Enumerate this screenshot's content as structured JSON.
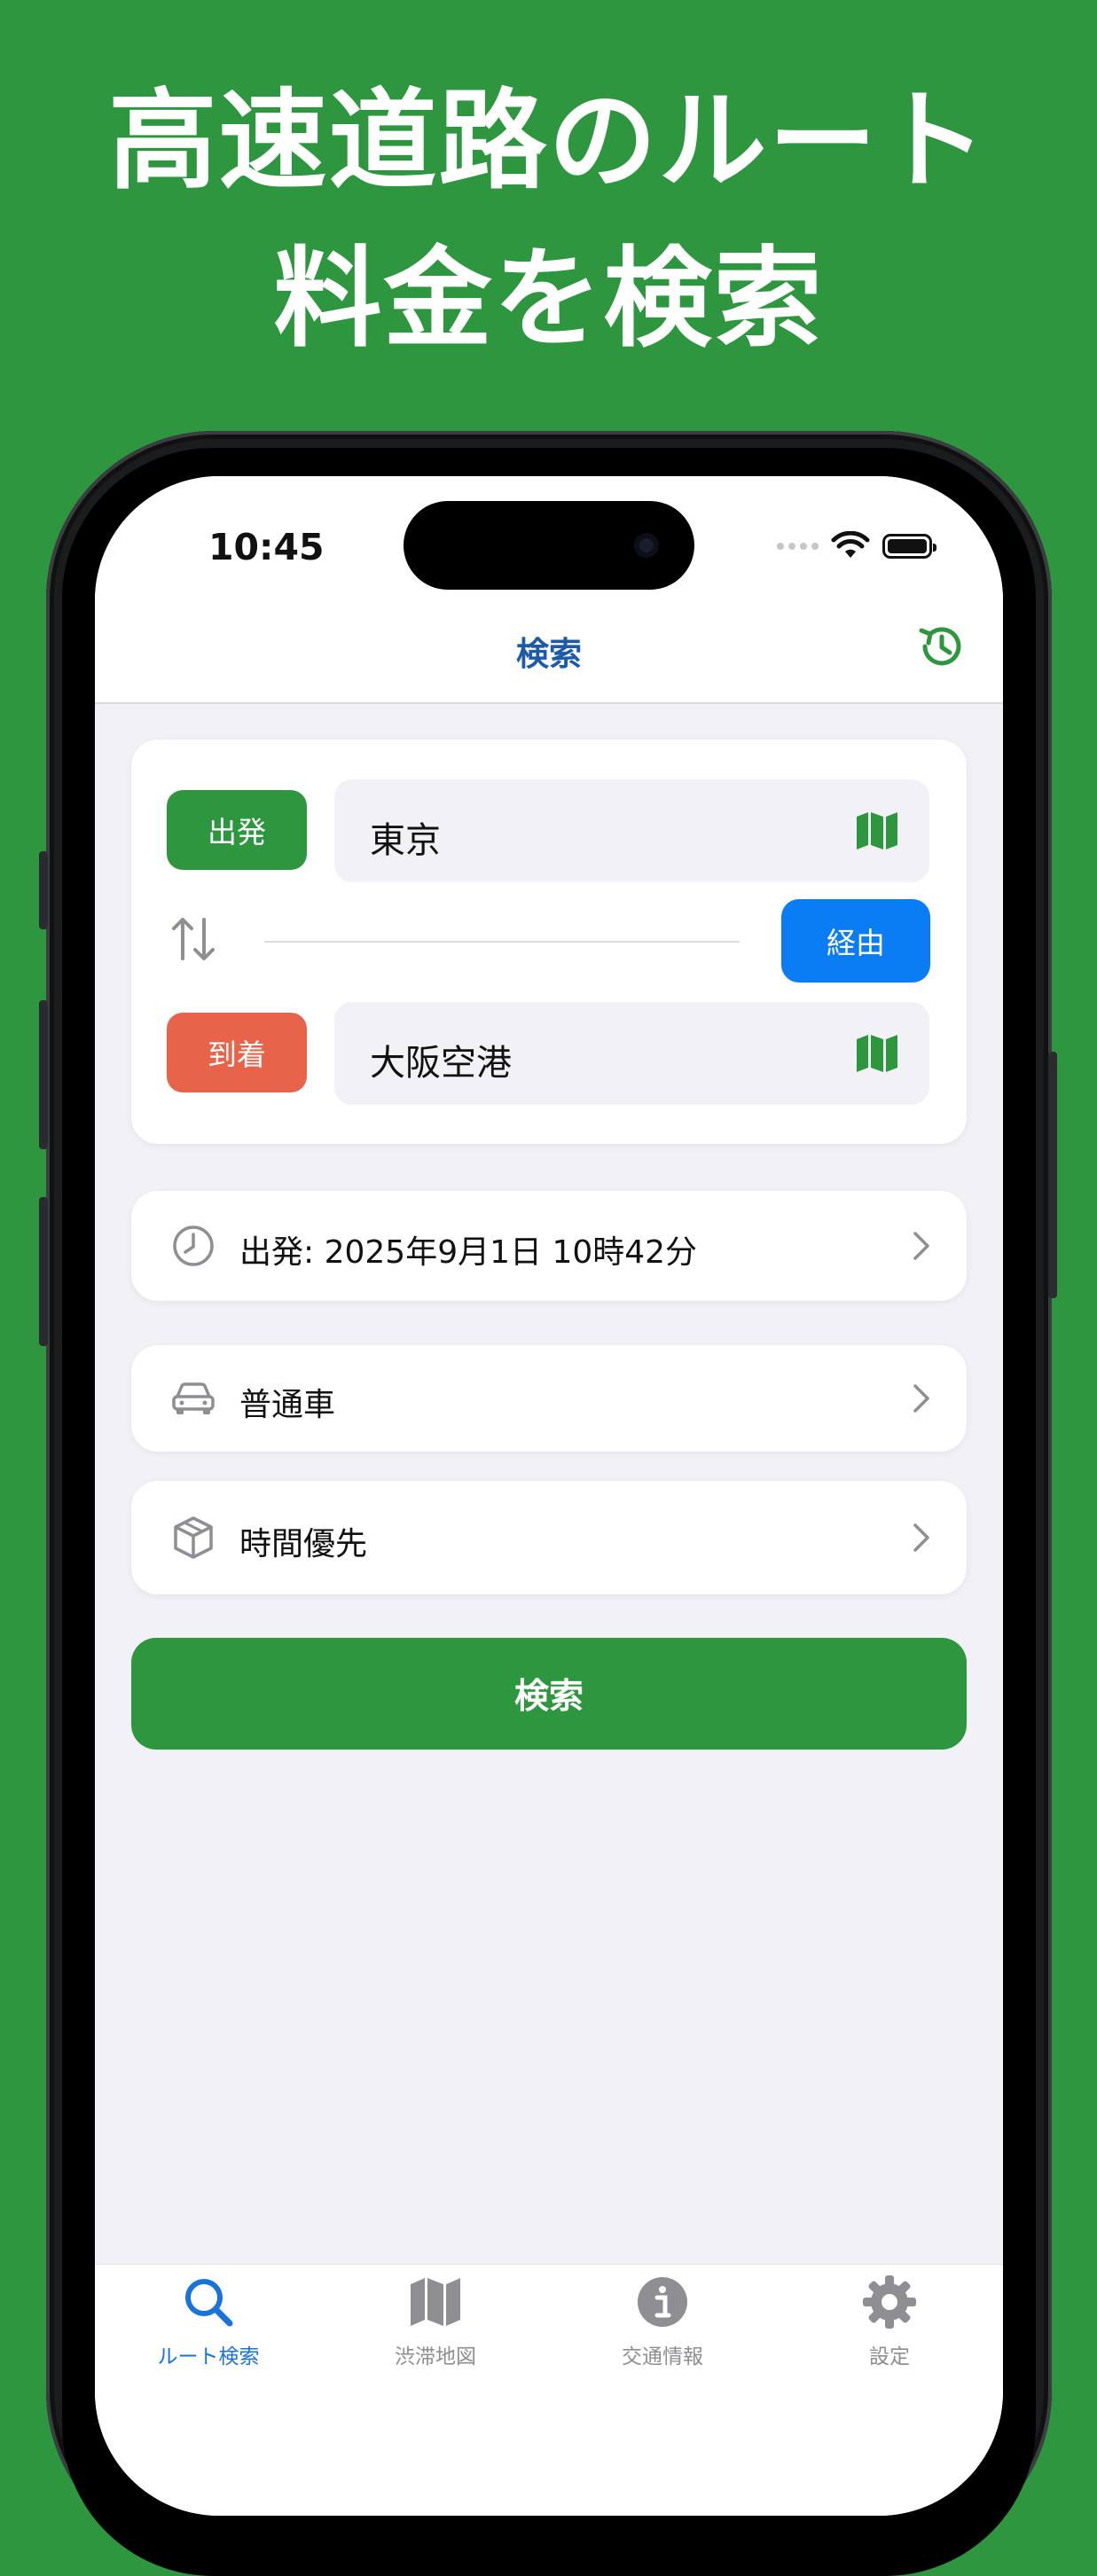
{
  "headline": {
    "line1": "高速道路のルート",
    "line2": "料金を検索"
  },
  "status_bar": {
    "time": "10:45"
  },
  "nav": {
    "title": "検索"
  },
  "route": {
    "departure_label": "出発",
    "departure_value": "東京",
    "arrival_label": "到着",
    "arrival_value": "大阪空港",
    "via_label": "経由"
  },
  "options": {
    "datetime": "出発: 2025年9月1日 10時42分",
    "vehicle": "普通車",
    "priority": "時間優先"
  },
  "search_button": "検索",
  "tabbar": {
    "tabs": [
      {
        "label": "ルート検索",
        "icon": "search-icon",
        "active": true
      },
      {
        "label": "渋滞地図",
        "icon": "map-icon",
        "active": false
      },
      {
        "label": "交通情報",
        "icon": "info-icon",
        "active": false
      },
      {
        "label": "設定",
        "icon": "gear-icon",
        "active": false
      }
    ]
  },
  "colors": {
    "background": "#2e963f",
    "departure": "#2e963f",
    "arrival": "#e7644b",
    "via": "#0a7cf4",
    "active_tab": "#1a73d9"
  }
}
